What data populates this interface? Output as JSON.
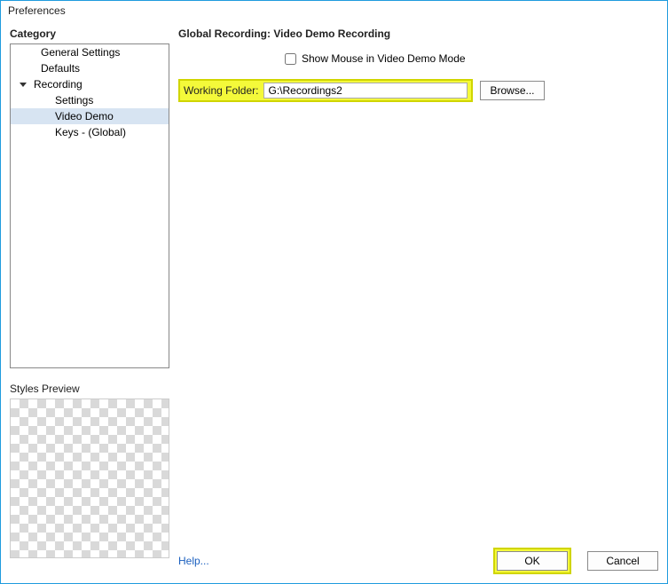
{
  "window": {
    "title": "Preferences"
  },
  "sidebar": {
    "heading": "Category",
    "items": [
      {
        "label": "General Settings",
        "depth": 0,
        "expandable": false,
        "selected": false
      },
      {
        "label": "Defaults",
        "depth": 0,
        "expandable": false,
        "selected": false
      },
      {
        "label": "Recording",
        "depth": 0,
        "expandable": true,
        "expanded": true,
        "selected": false
      },
      {
        "label": "Settings",
        "depth": 1,
        "expandable": false,
        "selected": false
      },
      {
        "label": "Video Demo",
        "depth": 1,
        "expandable": false,
        "selected": true
      },
      {
        "label": "Keys - (Global)",
        "depth": 1,
        "expandable": false,
        "selected": false
      }
    ],
    "styles_preview_label": "Styles Preview"
  },
  "main": {
    "section_title": "Global Recording: Video Demo Recording",
    "show_mouse": {
      "label": "Show Mouse in Video Demo Mode",
      "checked": false
    },
    "working_folder_label": "Working Folder:",
    "working_folder_value": "G:\\Recordings2",
    "browse_label": "Browse..."
  },
  "footer": {
    "help_label": "Help...",
    "ok_label": "OK",
    "cancel_label": "Cancel"
  }
}
